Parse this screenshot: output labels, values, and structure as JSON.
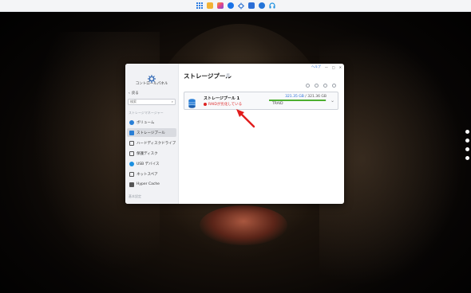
{
  "taskbar": {
    "icons": [
      {
        "name": "main-menu-icon",
        "color": "#2f7de1"
      },
      {
        "name": "file-station-icon",
        "color": "#f2b234"
      },
      {
        "name": "photos-icon",
        "color": "#e2458d"
      },
      {
        "name": "clock-icon",
        "color": "#1a73e8"
      },
      {
        "name": "control-panel-icon",
        "color": "#3a7bd5"
      },
      {
        "name": "notes-icon",
        "color": "#2d6fd6"
      },
      {
        "name": "security-icon",
        "color": "#2474d8"
      },
      {
        "name": "support-icon",
        "color": "#1a8fe0"
      }
    ]
  },
  "window": {
    "help_label": "ヘルプ",
    "app_title": "コントロールパネル",
    "back_label": "戻る",
    "search_placeholder": "検索",
    "section_storage": "ストレージマネージャー",
    "nav_items": [
      {
        "label": "ボリューム",
        "icon": "volume-icon",
        "color": "#2a7fd6"
      },
      {
        "label": "ストレージプール",
        "icon": "storage-pool-icon",
        "color": "#2a7fd6",
        "active": true
      },
      {
        "label": "ハードディスクドライブ",
        "icon": "hard-drive-icon",
        "color": "#555"
      },
      {
        "label": "保護ディスク",
        "icon": "protected-disk-icon",
        "color": "#555"
      },
      {
        "label": "USB デバイス",
        "icon": "usb-icon",
        "color": "#1a8fe0"
      },
      {
        "label": "ネットスペア",
        "icon": "net-spare-icon",
        "color": "#555"
      },
      {
        "label": "Hyper Cache",
        "icon": "hyper-cache-icon",
        "color": "#555"
      }
    ],
    "section_basic": "基本設定",
    "main_title": "ストレージプール",
    "info_icon": "i"
  },
  "pool": {
    "name": "ストレージプール 1",
    "status": "RAIDが劣化している",
    "used": "321.35 GB",
    "separator": " / ",
    "total": "321.36 GB",
    "usage_fraction": 0.99,
    "raid_type": "TRAID",
    "status_color": "#dd2222",
    "bar_color": "#4caf2f"
  }
}
